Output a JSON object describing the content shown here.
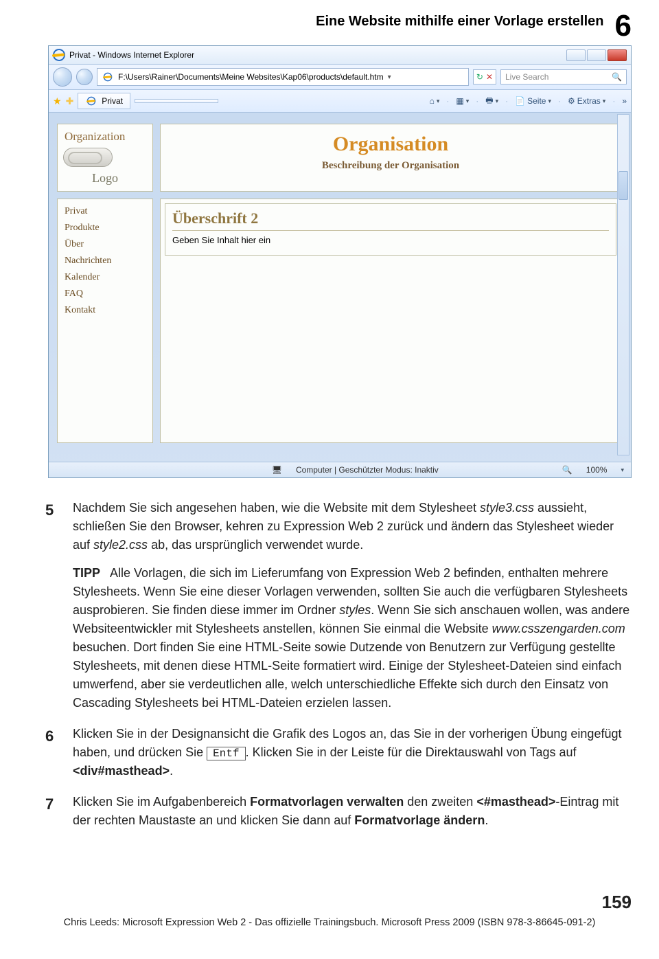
{
  "chapter": {
    "title": "Eine Website mithilfe einer Vorlage erstellen",
    "number": "6"
  },
  "browser": {
    "title": "Privat - Windows Internet Explorer",
    "address": "F:\\Users\\Rainer\\Documents\\Meine Websites\\Kap06\\products\\default.htm",
    "search_placeholder": "Live Search",
    "tab_label": "Privat",
    "toolbar": {
      "page": "Seite",
      "extras": "Extras"
    },
    "status_center": "Computer | Geschützter Modus: Inaktiv",
    "status_zoom": "100%"
  },
  "site": {
    "masthead_org_label": "Organization",
    "masthead_logo_label": "Logo",
    "org_title": "Organisation",
    "org_sub": "Beschreibung der Organisation",
    "nav": [
      "Privat",
      "Produkte",
      "Über",
      "Nachrichten",
      "Kalender",
      "FAQ",
      "Kontakt"
    ],
    "h2": "Überschrift 2",
    "content_placeholder": "Geben Sie Inhalt hier ein"
  },
  "steps": {
    "s5_a": "Nachdem Sie sich angesehen haben, wie die Website mit dem Stylesheet ",
    "s5_style3": "style3.css",
    "s5_b": " aussieht, schließen Sie den Browser, kehren zu Expression Web 2 zurück und ändern das Stylesheet wieder auf ",
    "s5_style2": "style2.css",
    "s5_c": " ab, das ursprünglich verwendet wurde.",
    "tip_label": "TIPP",
    "tip_a": "Alle Vorlagen, die sich im Lieferumfang von Expression Web 2 befinden, enthalten mehrere Stylesheets. Wenn Sie eine dieser Vorlagen verwenden, sollten Sie auch die verfügbaren Stylesheets ausprobieren. Sie finden diese immer im Ordner ",
    "tip_styles": "styles",
    "tip_b": ". Wenn Sie sich anschauen wollen, was andere Websiteentwickler mit Stylesheets anstellen, können Sie einmal die Website ",
    "tip_url": "www.csszengarden.com",
    "tip_c": " besuchen. Dort finden Sie eine HTML-Seite sowie Dutzende von Benutzern zur Verfügung gestellte Stylesheets, mit denen diese HTML-Seite formatiert wird. Einige der Stylesheet-Dateien sind einfach umwerfend, aber sie verdeutlichen alle, welch unterschiedliche Effekte sich durch den Einsatz von Cascading Stylesheets bei HTML-Dateien erzielen lassen.",
    "s6_a": "Klicken Sie in der Designansicht die Grafik des Logos an, das Sie in der vorherigen Übung eingefügt haben, und drücken Sie ",
    "s6_key": "Entf",
    "s6_b": ". Klicken Sie in der Leiste für die Direktauswahl von Tags auf ",
    "s6_tag": "<div#masthead>",
    "s6_c": ".",
    "s7_a": "Klicken Sie im Aufgabenbereich ",
    "s7_pane": "Formatvorlagen verwalten",
    "s7_b": " den zweiten ",
    "s7_tag": "<#masthead>",
    "s7_c": "-Eintrag mit der rechten Maustaste an und klicken Sie dann auf ",
    "s7_cmd": "Formatvorlage ändern",
    "s7_d": "."
  },
  "page_number": "159",
  "footline": "Chris Leeds: Microsoft Expression Web 2 - Das offizielle Trainingsbuch. Microsoft Press 2009 (ISBN 978-3-86645-091-2)"
}
